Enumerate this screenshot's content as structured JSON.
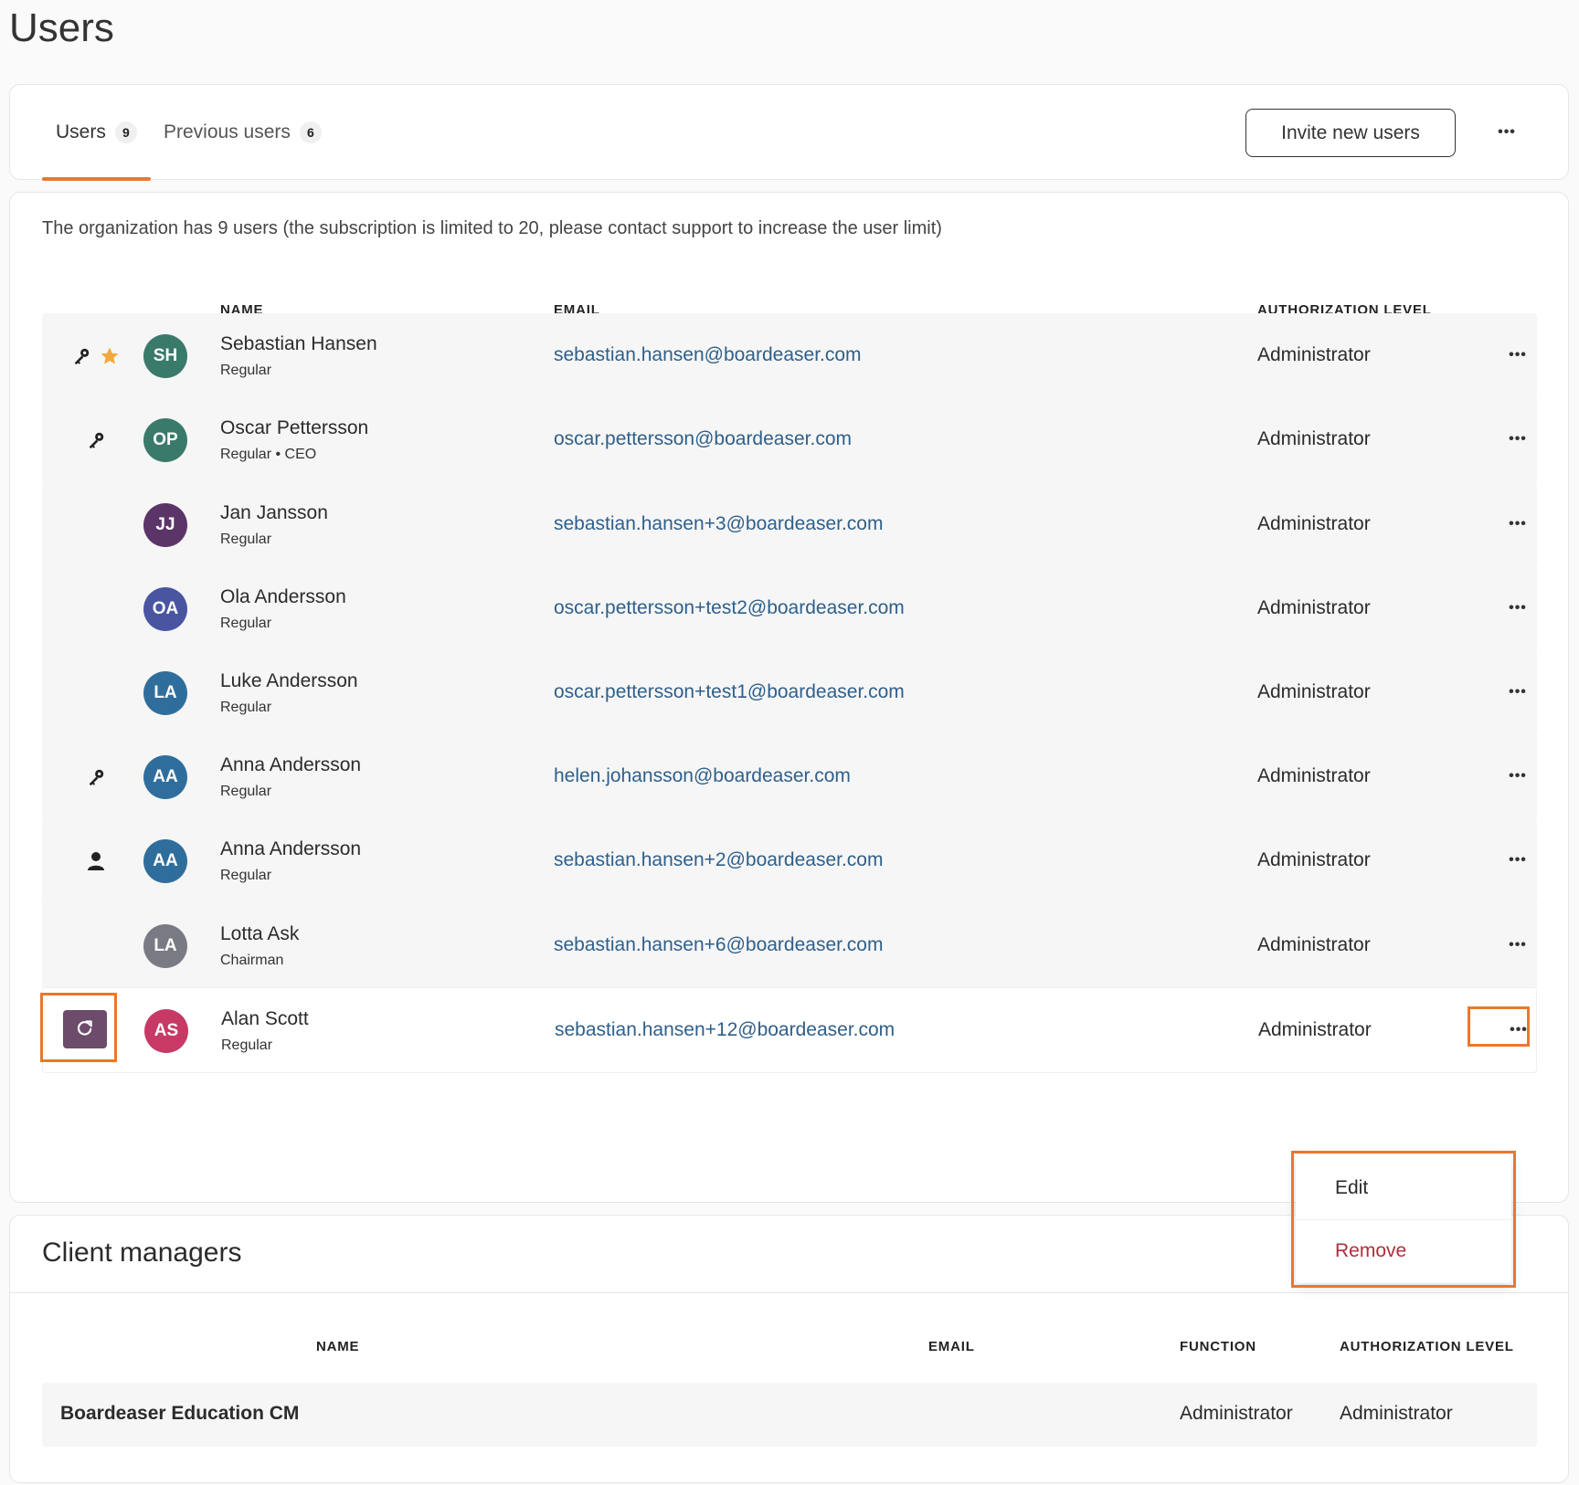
{
  "page": {
    "title": "Users"
  },
  "tabs": [
    {
      "label": "Users",
      "count": "9"
    },
    {
      "label": "Previous users",
      "count": "6"
    }
  ],
  "toolbar": {
    "invite_label": "Invite new users",
    "more_label": "•••"
  },
  "summary": "The organization has 9 users (the subscription is limited to 20, please contact support to increase the user limit)",
  "users_table": {
    "headers": {
      "name": "NAME",
      "email": "EMAIL",
      "auth": "AUTHORIZATION LEVEL"
    },
    "rows": [
      {
        "initials": "SH",
        "avatar_color": "#3a7a6b",
        "name": "Sebastian Hansen",
        "sub": "Regular",
        "email": "sebastian.hansen@boardeaser.com",
        "auth": "Administrator",
        "icons": [
          "key-icon",
          "star-icon"
        ]
      },
      {
        "initials": "OP",
        "avatar_color": "#3a7a6b",
        "name": "Oscar Pettersson",
        "sub": "Regular • CEO",
        "email": "oscar.pettersson@boardeaser.com",
        "auth": "Administrator",
        "icons": [
          "key-icon"
        ]
      },
      {
        "initials": "JJ",
        "avatar_color": "#5b3468",
        "name": "Jan Jansson",
        "sub": "Regular",
        "email": "sebastian.hansen+3@boardeaser.com",
        "auth": "Administrator",
        "icons": []
      },
      {
        "initials": "OA",
        "avatar_color": "#4a55a2",
        "name": "Ola Andersson",
        "sub": "Regular",
        "email": "oscar.pettersson+test2@boardeaser.com",
        "auth": "Administrator",
        "icons": []
      },
      {
        "initials": "LA",
        "avatar_color": "#2f6e9c",
        "name": "Luke Andersson",
        "sub": "Regular",
        "email": "oscar.pettersson+test1@boardeaser.com",
        "auth": "Administrator",
        "icons": []
      },
      {
        "initials": "AA",
        "avatar_color": "#2f6e9c",
        "name": "Anna Andersson",
        "sub": "Regular",
        "email": "helen.johansson@boardeaser.com",
        "auth": "Administrator",
        "icons": [
          "key-icon"
        ]
      },
      {
        "initials": "AA",
        "avatar_color": "#2f6e9c",
        "name": "Anna Andersson",
        "sub": "Regular",
        "email": "sebastian.hansen+2@boardeaser.com",
        "auth": "Administrator",
        "icons": [
          "person-icon"
        ]
      },
      {
        "initials": "LA",
        "avatar_color": "#7a7a84",
        "name": "Lotta Ask",
        "sub": "Chairman",
        "email": "sebastian.hansen+6@boardeaser.com",
        "auth": "Administrator",
        "icons": []
      },
      {
        "initials": "AS",
        "avatar_color": "#c73a66",
        "name": "Alan Scott",
        "sub": "Regular",
        "email": "sebastian.hansen+12@boardeaser.com",
        "auth": "Administrator",
        "icons": [
          "refresh-icon"
        ]
      }
    ]
  },
  "dropdown": {
    "edit": "Edit",
    "remove": "Remove"
  },
  "client_managers": {
    "title": "Client managers",
    "headers": {
      "name": "NAME",
      "email": "EMAIL",
      "function": "FUNCTION",
      "auth": "AUTHORIZATION LEVEL"
    },
    "rows": [
      {
        "name": "Boardeaser Education CM",
        "email": "",
        "function": "Administrator",
        "auth": "Administrator"
      }
    ]
  },
  "colors": {
    "accent": "#e9772f",
    "link": "#2f5f8a",
    "danger": "#b02d3a",
    "star": "#f2a93b"
  }
}
